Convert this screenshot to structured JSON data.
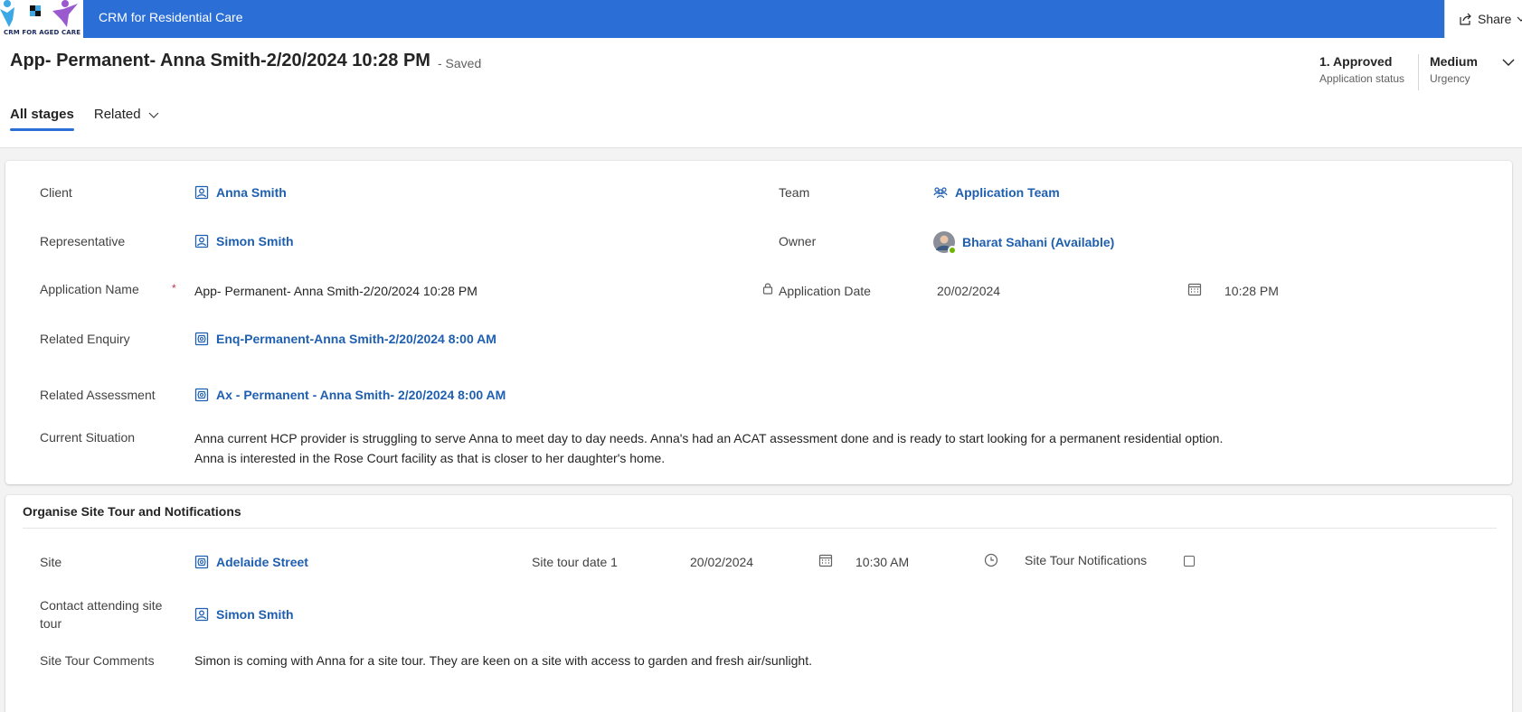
{
  "app": {
    "logo_text": "CRM FOR AGED CARE",
    "title": "CRM for Residential Care",
    "share_label": "Share"
  },
  "record": {
    "title": "App- Permanent- Anna Smith-2/20/2024 10:28 PM",
    "saved_status": "- Saved"
  },
  "header_fields": {
    "status_value": "1. Approved",
    "status_label": "Application status",
    "urgency_value": "Medium",
    "urgency_label": "Urgency"
  },
  "tabs": [
    {
      "label": "All stages",
      "active": true
    },
    {
      "label": "Related",
      "active": false
    }
  ],
  "main_section": {
    "client_label": "Client",
    "client_value": "Anna Smith",
    "team_label": "Team",
    "team_value": "Application Team",
    "representative_label": "Representative",
    "representative_value": "Simon Smith",
    "owner_label": "Owner",
    "owner_value": "Bharat Sahani (Available)",
    "application_name_label": "Application Name",
    "application_name_required": "*",
    "application_name_value": "App- Permanent- Anna Smith-2/20/2024 10:28 PM",
    "application_date_label": "Application Date",
    "application_date_value": "20/02/2024",
    "application_time_value": "10:28 PM",
    "related_enquiry_label": "Related Enquiry",
    "related_enquiry_value": "Enq-Permanent-Anna Smith-2/20/2024 8:00 AM",
    "related_assessment_label": "Related Assessment",
    "related_assessment_value": "Ax - Permanent - Anna Smith- 2/20/2024 8:00 AM",
    "current_situation_label": "Current Situation",
    "current_situation_line1": "Anna current HCP provider is struggling to serve Anna to meet day to day needs. Anna's had an ACAT assessment done and is ready to start looking for a permanent residential option.",
    "current_situation_line2": "Anna is interested in the Rose Court facility as that is closer to her daughter's home."
  },
  "site_tour_section": {
    "title": "Organise Site Tour and Notifications",
    "site_label": "Site",
    "site_value": "Adelaide Street",
    "tour_date_label": "Site tour date 1",
    "tour_date_value": "20/02/2024",
    "tour_time_value": "10:30 AM",
    "notifications_label": "Site Tour Notifications",
    "notifications_checked": false,
    "contact_label_line1": "Contact attending site",
    "contact_label_line2": "tour",
    "contact_value": "Simon Smith",
    "comments_label": "Site Tour Comments",
    "comments_value": "Simon is coming with Anna for a site tour. They are keen on a site with access to garden and fresh air/sunlight."
  },
  "colors": {
    "topbar": "#2b6fd6",
    "link": "#1f5fb0",
    "required": "#c4314b",
    "presence_available": "#6bb700"
  },
  "icons": [
    "share-icon",
    "chevron-down-icon",
    "contact-icon",
    "team-icon",
    "lock-icon",
    "calendar-icon",
    "clock-icon",
    "entity-icon"
  ]
}
